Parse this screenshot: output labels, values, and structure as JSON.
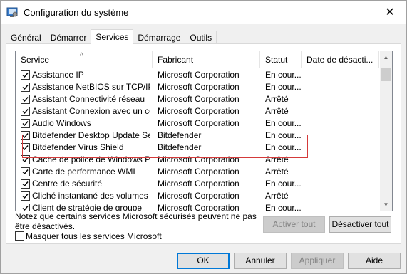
{
  "window": {
    "title": "Configuration du système",
    "close_glyph": "✕"
  },
  "tabs": [
    {
      "label": "Général"
    },
    {
      "label": "Démarrer"
    },
    {
      "label": "Services",
      "active": true
    },
    {
      "label": "Démarrage"
    },
    {
      "label": "Outils"
    }
  ],
  "list": {
    "columns": {
      "service": "Service",
      "maker": "Fabricant",
      "status": "Statut",
      "disabled_date": "Date de désacti..."
    },
    "sort_glyph": "^",
    "rows": [
      {
        "name": "Assistance IP",
        "maker": "Microsoft Corporation",
        "status": "En cour..."
      },
      {
        "name": "Assistance NetBIOS sur TCP/IP",
        "maker": "Microsoft Corporation",
        "status": "En cour..."
      },
      {
        "name": "Assistant Connectivité réseau",
        "maker": "Microsoft Corporation",
        "status": "Arrêté"
      },
      {
        "name": "Assistant Connexion avec un co...",
        "maker": "Microsoft Corporation",
        "status": "Arrêté"
      },
      {
        "name": "Audio Windows",
        "maker": "Microsoft Corporation",
        "status": "En cour..."
      },
      {
        "name": "Bitdefender Desktop Update Ser...",
        "maker": "Bitdefender",
        "status": "En cour..."
      },
      {
        "name": "Bitdefender Virus Shield",
        "maker": "Bitdefender",
        "status": "En cour..."
      },
      {
        "name": "Cache de police de Windows Pre...",
        "maker": "Microsoft Corporation",
        "status": "Arrêté"
      },
      {
        "name": "Carte de performance WMI",
        "maker": "Microsoft Corporation",
        "status": "Arrêté"
      },
      {
        "name": "Centre de sécurité",
        "maker": "Microsoft Corporation",
        "status": "En cour..."
      },
      {
        "name": "Cliché instantané des volumes",
        "maker": "Microsoft Corporation",
        "status": "Arrêté"
      },
      {
        "name": "Client de stratégie de groupe",
        "maker": "Microsoft Corporation",
        "status": "En cour..."
      }
    ]
  },
  "notice": "Notez que certains services Microsoft sécurisés peuvent ne pas être désactivés.",
  "buttons": {
    "enable_all": "Activer tout",
    "disable_all": "Désactiver tout",
    "ok": "OK",
    "cancel": "Annuler",
    "apply": "Appliquer",
    "help": "Aide"
  },
  "hide_ms_label": "Masquer tous les services Microsoft",
  "colors": {
    "highlight_border": "#d43a3a",
    "default_button_border": "#0078d7"
  }
}
